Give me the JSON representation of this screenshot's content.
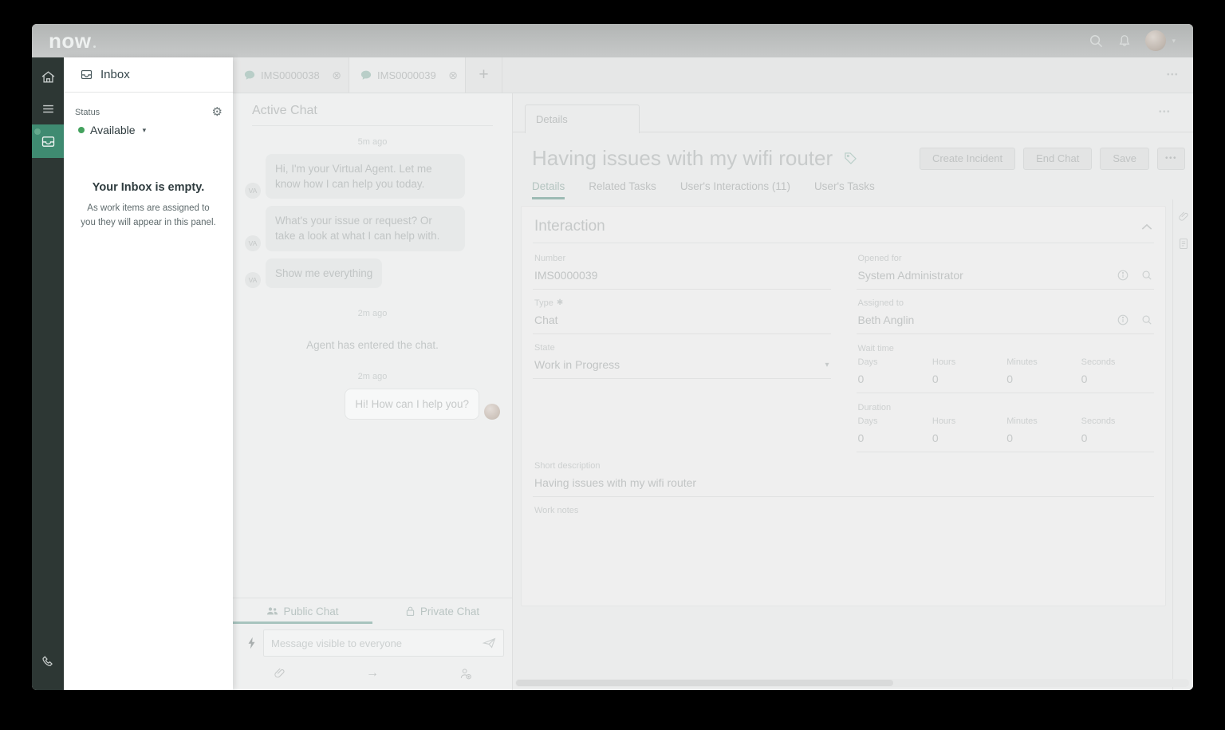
{
  "colors": {
    "nav_bg": "#2d3734",
    "nav_active_green": "#3f8b71",
    "available_dot_green": "#44a25e",
    "dim_teal_accent": "#a8c4be",
    "sub_tab_teal_underline": "#9dbbb4",
    "inbox_text_dark": "#2e3b3e",
    "dimmed_text": "#c2c5c5",
    "topbar_gray": "#c0c2c2"
  },
  "icons": {
    "gear": "⚙",
    "caret_down": "▾",
    "close": "⊗",
    "plus": "+",
    "arrow_right": "→",
    "more": "•••"
  },
  "header": {
    "logo": "now"
  },
  "inbox": {
    "title": "Inbox",
    "status_label": "Status",
    "availability": "Available",
    "empty_title": "Your Inbox is empty.",
    "empty_desc": "As work items are assigned to you they will appear in this panel."
  },
  "tabs": [
    {
      "label": "IMS0000038"
    },
    {
      "label": "IMS0000039"
    }
  ],
  "chat": {
    "title": "Active Chat",
    "timestamp1": "5m ago",
    "va_initials": "VA",
    "messages": [
      "Hi, I'm your Virtual Agent. Let me know how I can help you today.",
      "What's your issue or request? Or take a look at what I can help with.",
      "Show me everything"
    ],
    "timestamp2": "2m ago",
    "system_message": "Agent has entered the chat.",
    "timestamp3": "2m ago",
    "agent_message": "Hi! How can I help you?",
    "public_tab": "Public Chat",
    "private_tab": "Private Chat",
    "input_placeholder": "Message visible to everyone"
  },
  "details": {
    "panel_tab": "Details",
    "title": "Having issues with my wifi router",
    "buttons": {
      "create_incident": "Create Incident",
      "end_chat": "End Chat",
      "save": "Save"
    },
    "sub_tabs": [
      "Details",
      "Related Tasks",
      "User's Interactions (11)",
      "User's Tasks"
    ],
    "section_title": "Interaction",
    "fields": {
      "number": {
        "label": "Number",
        "value": "IMS0000039"
      },
      "type": {
        "label": "Type",
        "required_marker": "✱",
        "value": "Chat"
      },
      "state": {
        "label": "State",
        "value": "Work in Progress"
      },
      "opened_for": {
        "label": "Opened for",
        "value": "System Administrator"
      },
      "assigned_to": {
        "label": "Assigned to",
        "value": "Beth Anglin"
      },
      "wait_time": {
        "label": "Wait time",
        "columns": [
          "Days",
          "Hours",
          "Minutes",
          "Seconds"
        ],
        "values": [
          "0",
          "0",
          "0",
          "0"
        ]
      },
      "duration": {
        "label": "Duration",
        "columns": [
          "Days",
          "Hours",
          "Minutes",
          "Seconds"
        ],
        "values": [
          "0",
          "0",
          "0",
          "0"
        ]
      },
      "short_description": {
        "label": "Short description",
        "value": "Having issues with my wifi router"
      },
      "work_notes": {
        "label": "Work notes",
        "value": ""
      }
    }
  }
}
